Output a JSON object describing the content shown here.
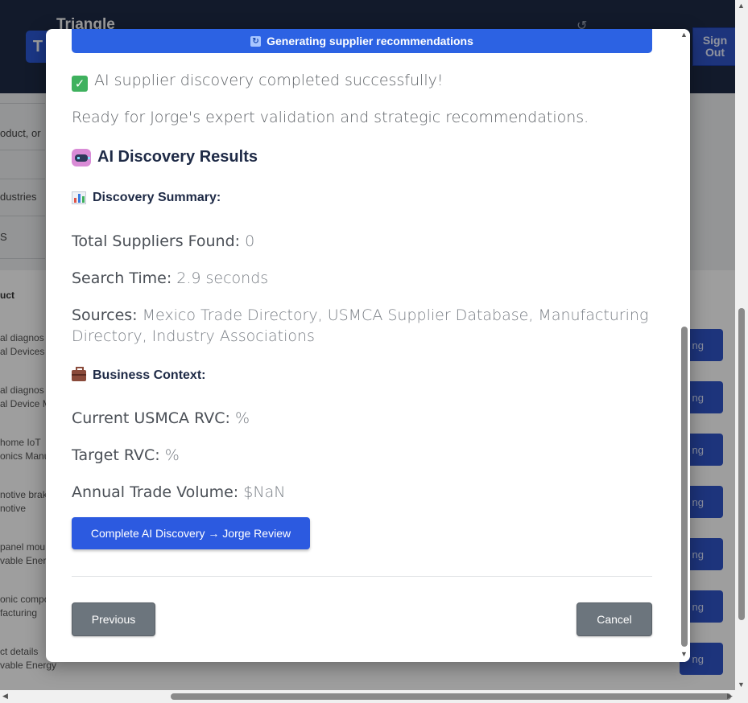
{
  "app": {
    "brand": "Triangle",
    "logo_letter": "T",
    "sign_out": "Sign Out"
  },
  "background": {
    "filters": [
      "oduct, or",
      "dustries",
      "S"
    ],
    "table_header": "uct",
    "rows": [
      {
        "line1": "al diagnos",
        "line2": "al Devices",
        "button": "ng"
      },
      {
        "line1": "al diagnos",
        "line2": "al Device M",
        "button": "ng"
      },
      {
        "line1": " home IoT",
        "line2": "onics Manu",
        "button": "ng"
      },
      {
        "line1": "notive brak",
        "line2": "notive",
        "button": "ng"
      },
      {
        "line1": "panel mou",
        "line2": "vable Energ",
        "button": "ng"
      },
      {
        "line1": "onic compo",
        "line2": "facturing",
        "button": "ng"
      },
      {
        "line1": "ct details",
        "line2": "vable Energy",
        "button": "ng"
      }
    ]
  },
  "modal": {
    "progress_label": "Generating supplier recommendations",
    "success_message": "AI supplier discovery completed successfully!",
    "ready_message": "Ready for Jorge's expert validation and strategic recommendations.",
    "results_title": "AI Discovery Results",
    "summary_title": "Discovery Summary:",
    "summary": {
      "total_label": "Total Suppliers Found:",
      "total_value": "0",
      "time_label": "Search Time:",
      "time_value": "2.9 seconds",
      "sources_label": "Sources:",
      "sources_value": "Mexico Trade Directory, USMCA Supplier Database, Manufacturing Directory, Industry Associations"
    },
    "context_title": "Business Context:",
    "context": {
      "current_rvc_label": "Current USMCA RVC:",
      "current_rvc_value": "%",
      "target_rvc_label": "Target RVC:",
      "target_rvc_value": "%",
      "volume_label": "Annual Trade Volume:",
      "volume_value": "$NaN"
    },
    "complete_button": "Complete AI Discovery → Jorge Review",
    "previous_button": "Previous",
    "cancel_button": "Cancel"
  },
  "colors": {
    "primary": "#2c5ae0",
    "header_bg": "#1e2a46",
    "secondary_button": "#6c757d",
    "success": "#3fb15e"
  }
}
